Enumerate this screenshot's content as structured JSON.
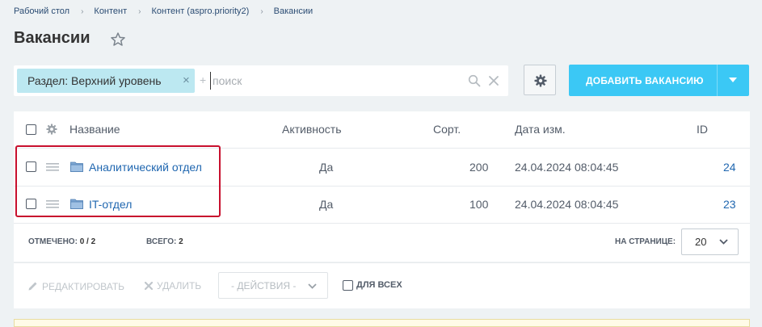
{
  "breadcrumb": [
    "Рабочий стол",
    "Контент",
    "Контент (aspro.priority2)",
    "Вакансии"
  ],
  "breadcrumb_separator": "›",
  "page_title": "Вакансии",
  "filter": {
    "chip_label": "Раздел: Верхний уровень",
    "chip_close": "×",
    "plus": "+",
    "search_placeholder": "поиск"
  },
  "toolbar": {
    "add_label": "ДОБАВИТЬ ВАКАНСИЮ"
  },
  "grid": {
    "columns": {
      "name": "Название",
      "active": "Активность",
      "sort": "Сорт.",
      "date": "Дата изм.",
      "id": "ID"
    },
    "rows": [
      {
        "name": "Аналитический отдел",
        "active": "Да",
        "sort": "200",
        "date": "24.04.2024 08:04:45",
        "id": "24"
      },
      {
        "name": "IT-отдел",
        "active": "Да",
        "sort": "100",
        "date": "24.04.2024 08:04:45",
        "id": "23"
      }
    ],
    "footer": {
      "selected_label": "ОТМЕЧЕНО:",
      "selected_value": "0 / 2",
      "total_label": "ВСЕГО:",
      "total_value": "2",
      "per_page_label": "НА СТРАНИЦЕ:",
      "per_page_value": "20"
    }
  },
  "actions": {
    "edit_label": "РЕДАКТИРОВАТЬ",
    "delete_label": "УДАЛИТЬ",
    "select_label": "- ДЕЙСТВИЯ -",
    "for_all_label": "ДЛЯ ВСЕХ"
  },
  "colors": {
    "accent": "#3bc8f5",
    "chip_bg": "#bce8f1",
    "link": "#2067b0",
    "highlight": "#c8102e",
    "background": "#eef2f4"
  }
}
